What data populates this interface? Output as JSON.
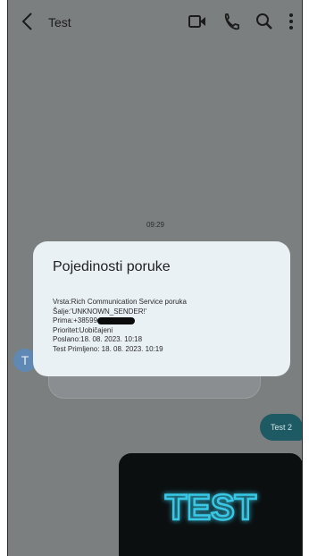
{
  "header": {
    "title": "Test",
    "icons": [
      "back-arrow-icon",
      "video-call-icon",
      "phone-icon",
      "search-icon",
      "more-vert-icon"
    ]
  },
  "conversation": {
    "timestamp": "09:29",
    "avatar_letter": "T",
    "outgoing_message": "Test 2",
    "media_text": "TEST"
  },
  "details_dialog": {
    "title": "Pojedinosti poruke",
    "type_line": "Vrsta:Rich Communication Service poruka",
    "sender_line": "Šalje:'UNKNOWN_SENDER!'",
    "recipient_prefix": "Prima:+38599",
    "priority_line": "Prioritet:Uobičajeni",
    "sent_line": "Poslano:18. 08. 2023. 10:18",
    "received_line": "Test Primljeno: 18. 08. 2023. 10:19"
  },
  "colors": {
    "dim_background": "#7c7f7f",
    "dialog_background": "#eaf1f5",
    "outgoing_bubble": "#1e5a63",
    "avatar": "#5f89b4",
    "neon": "#37c8e6"
  }
}
